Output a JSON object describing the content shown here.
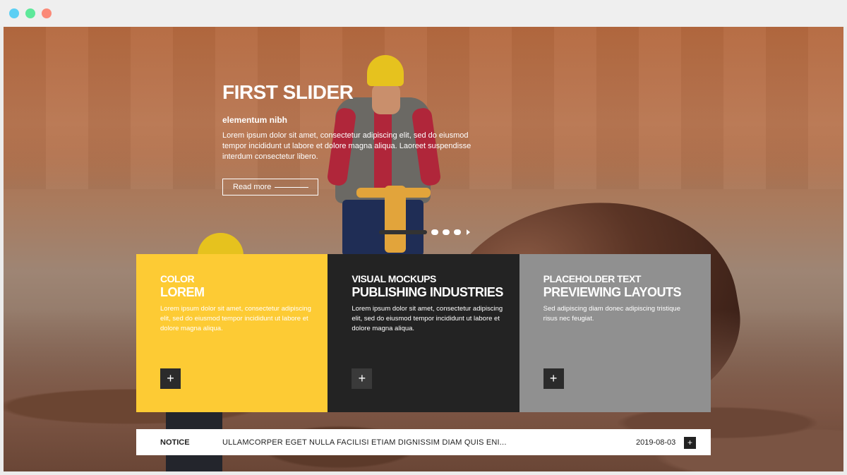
{
  "window": {
    "dots": [
      "#5ccff4",
      "#5ee89a",
      "#fb8a78"
    ]
  },
  "slider": {
    "title": "FIRST SLIDER",
    "subtitle": "elementum nibh",
    "body": "Lorem ipsum dolor sit amet, consectetur adipiscing elit, sed do eiusmod tempor incididunt ut labore et dolore magna aliqua. Laoreet suspendisse interdum consectetur libero.",
    "read_more": "Read more",
    "pager": {
      "active_index": 0,
      "count": 4
    }
  },
  "cards": [
    {
      "small": "COLOR",
      "big": "LOREM",
      "text": "Lorem ipsum dolor sit amet, consectetur adipiscing elit, sed do eiusmod tempor incididunt ut labore et dolore magna aliqua.",
      "button": "+",
      "color": "#fdcb34"
    },
    {
      "small": "VISUAL MOCKUPS",
      "big": "PUBLISHING INDUSTRIES",
      "text": "Lorem ipsum dolor sit amet, consectetur adipiscing elit, sed do eiusmod tempor incididunt ut labore et dolore magna aliqua.",
      "button": "+",
      "color": "#232323"
    },
    {
      "small": "PLACEHOLDER TEXT",
      "big": "PREVIEWING LAYOUTS",
      "text": "Sed adipiscing diam donec adipiscing tristique risus nec feugiat.",
      "button": "+",
      "color": "#909090"
    }
  ],
  "notice": {
    "label": "NOTICE",
    "text": "ULLAMCORPER EGET NULLA FACILISI ETIAM DIGNISSIM DIAM QUIS ENI...",
    "date": "2019-08-03",
    "button": "+"
  }
}
